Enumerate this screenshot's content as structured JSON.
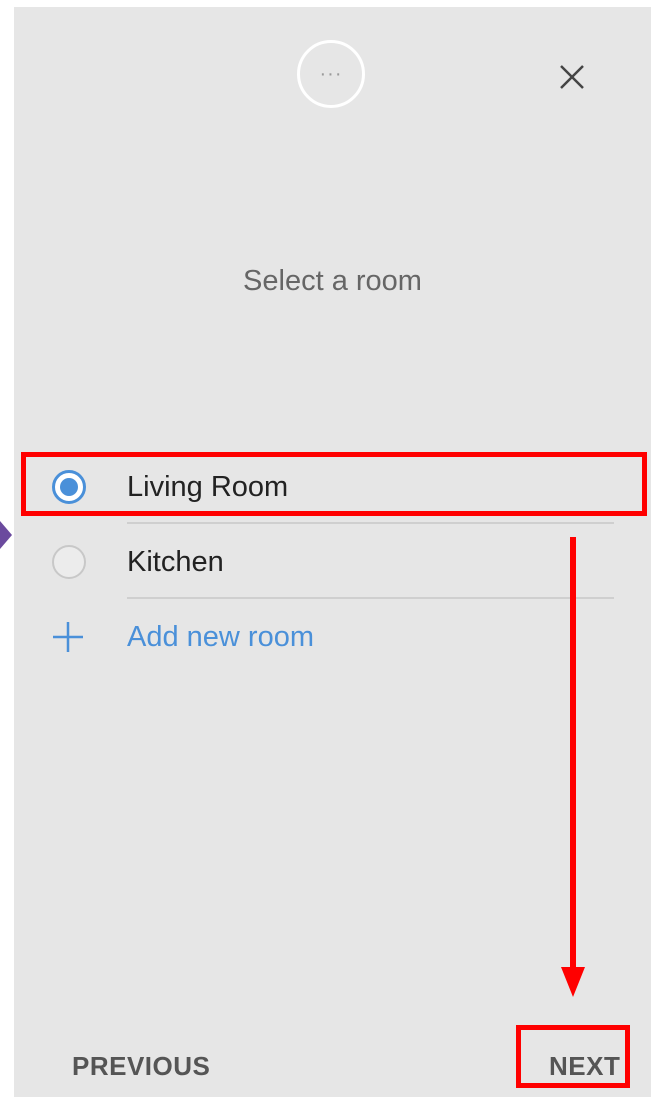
{
  "header": {
    "progress_icon": "more-dots-icon",
    "progress_glyph": "···",
    "close_icon": "close-icon"
  },
  "title": "Select a room",
  "rooms": [
    {
      "label": "Living Room",
      "selected": true
    },
    {
      "label": "Kitchen",
      "selected": false
    }
  ],
  "add_room": {
    "label": "Add new room",
    "icon": "plus-icon"
  },
  "footer": {
    "previous_label": "PREVIOUS",
    "next_label": "NEXT"
  },
  "colors": {
    "accent": "#4a90d9",
    "annotation": "#ff0000",
    "background": "#e6e6e6"
  }
}
